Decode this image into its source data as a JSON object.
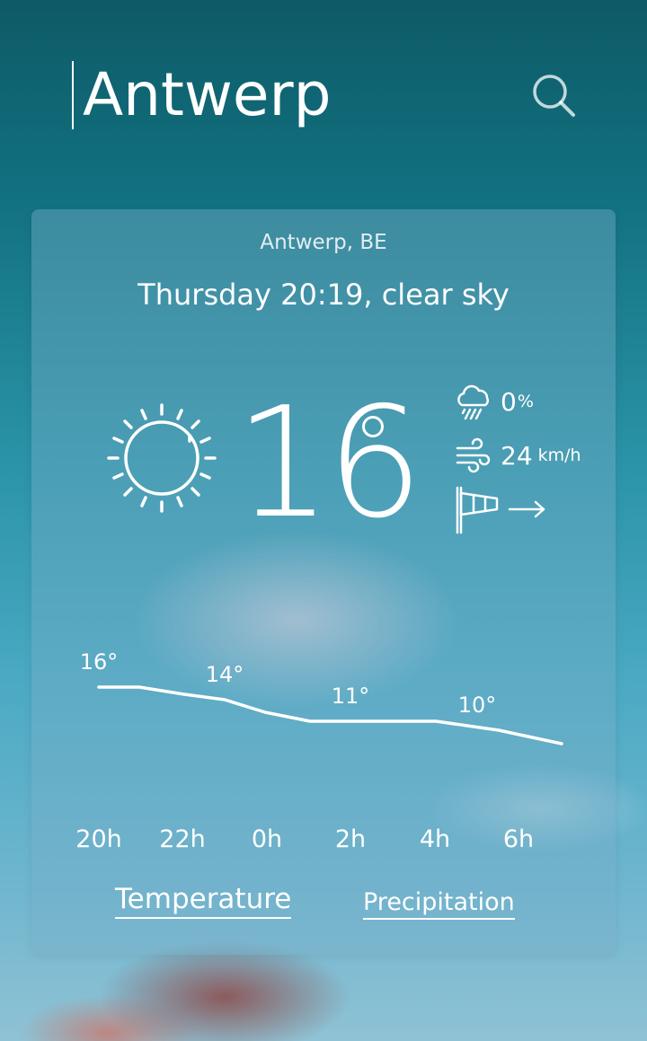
{
  "search": {
    "city": "Antwerp"
  },
  "card": {
    "location": "Antwerp, BE",
    "datetime": "Thursday 20:19, clear sky",
    "temperature": "16",
    "precipitation": {
      "value": "0",
      "unit": "%"
    },
    "wind": {
      "value": "24",
      "unit": "km/h",
      "direction": "east"
    }
  },
  "chart_data": {
    "type": "line",
    "x": [
      "20h",
      "22h",
      "0h",
      "2h",
      "4h",
      "6h"
    ],
    "series": [
      {
        "values": [
          16,
          14,
          11,
          10
        ]
      }
    ],
    "point_labels": [
      "16°",
      "14°",
      "11°",
      "10°"
    ]
  },
  "tabs": {
    "temperature": "Temperature",
    "precipitation": "Precipitation"
  },
  "colors": {
    "text": "#ffffff",
    "card_overlay": "rgba(120,175,200,0.42)",
    "sky_top": "#0e5a66",
    "sky_bottom": "#8fc2d4"
  }
}
